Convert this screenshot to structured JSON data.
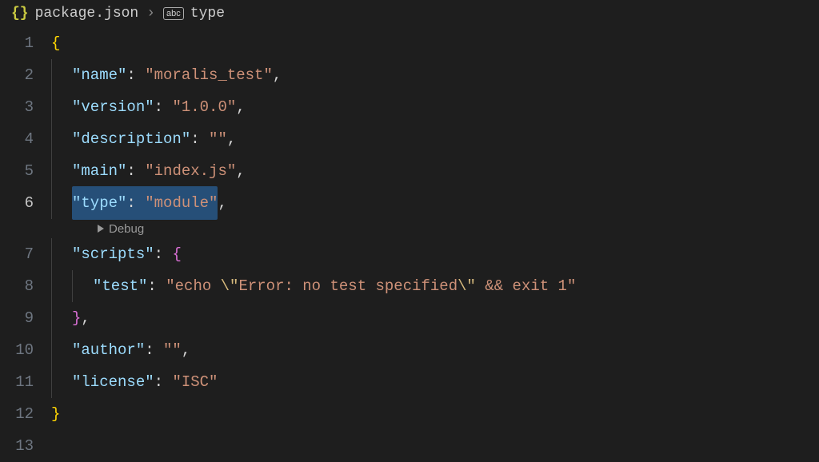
{
  "breadcrumb": {
    "file_icon": "{}",
    "filename": "package.json",
    "separator": "›",
    "symbol_icon": "abc",
    "symbol": "type"
  },
  "codelens": {
    "label": "Debug"
  },
  "active_line": 6,
  "code": {
    "lines": [
      {
        "n": 1,
        "indent": 0,
        "guide": false,
        "tokens": [
          {
            "t": "{",
            "c": "brace"
          }
        ]
      },
      {
        "n": 2,
        "indent": 1,
        "guide": true,
        "tokens": [
          {
            "t": "\"name\"",
            "c": "key"
          },
          {
            "t": ": ",
            "c": "punc"
          },
          {
            "t": "\"moralis_test\"",
            "c": "str"
          },
          {
            "t": ",",
            "c": "punc"
          }
        ]
      },
      {
        "n": 3,
        "indent": 1,
        "guide": true,
        "tokens": [
          {
            "t": "\"version\"",
            "c": "key"
          },
          {
            "t": ": ",
            "c": "punc"
          },
          {
            "t": "\"1.0.0\"",
            "c": "str"
          },
          {
            "t": ",",
            "c": "punc"
          }
        ]
      },
      {
        "n": 4,
        "indent": 1,
        "guide": true,
        "tokens": [
          {
            "t": "\"description\"",
            "c": "key"
          },
          {
            "t": ": ",
            "c": "punc"
          },
          {
            "t": "\"\"",
            "c": "str"
          },
          {
            "t": ",",
            "c": "punc"
          }
        ]
      },
      {
        "n": 5,
        "indent": 1,
        "guide": true,
        "tokens": [
          {
            "t": "\"main\"",
            "c": "key"
          },
          {
            "t": ": ",
            "c": "punc"
          },
          {
            "t": "\"index.js\"",
            "c": "str"
          },
          {
            "t": ",",
            "c": "punc"
          }
        ]
      },
      {
        "n": 6,
        "indent": 1,
        "guide": true,
        "highlight": true,
        "tokens": [
          {
            "t": "\"type\"",
            "c": "key"
          },
          {
            "t": ": ",
            "c": "punc"
          },
          {
            "t": "\"module\"",
            "c": "str"
          }
        ],
        "trailing": [
          {
            "t": ",",
            "c": "punc"
          }
        ]
      },
      {
        "n": 7,
        "indent": 1,
        "guide": true,
        "tokens": [
          {
            "t": "\"scripts\"",
            "c": "key"
          },
          {
            "t": ": ",
            "c": "punc"
          },
          {
            "t": "{",
            "c": "brace2"
          }
        ]
      },
      {
        "n": 8,
        "indent": 2,
        "guide": true,
        "tokens": [
          {
            "t": "\"test\"",
            "c": "key"
          },
          {
            "t": ": ",
            "c": "punc"
          },
          {
            "t": "\"echo ",
            "c": "str"
          },
          {
            "t": "\\\"",
            "c": "esc"
          },
          {
            "t": "Error: no test specified",
            "c": "str"
          },
          {
            "t": "\\\"",
            "c": "esc"
          },
          {
            "t": " && exit 1\"",
            "c": "str"
          }
        ]
      },
      {
        "n": 9,
        "indent": 1,
        "guide": true,
        "tokens": [
          {
            "t": "}",
            "c": "brace2"
          },
          {
            "t": ",",
            "c": "punc"
          }
        ]
      },
      {
        "n": 10,
        "indent": 1,
        "guide": true,
        "tokens": [
          {
            "t": "\"author\"",
            "c": "key"
          },
          {
            "t": ": ",
            "c": "punc"
          },
          {
            "t": "\"\"",
            "c": "str"
          },
          {
            "t": ",",
            "c": "punc"
          }
        ]
      },
      {
        "n": 11,
        "indent": 1,
        "guide": true,
        "tokens": [
          {
            "t": "\"license\"",
            "c": "key"
          },
          {
            "t": ": ",
            "c": "punc"
          },
          {
            "t": "\"ISC\"",
            "c": "str"
          }
        ]
      },
      {
        "n": 12,
        "indent": 0,
        "guide": false,
        "tokens": [
          {
            "t": "}",
            "c": "brace"
          }
        ]
      },
      {
        "n": 13,
        "indent": 0,
        "guide": false,
        "tokens": []
      }
    ]
  }
}
